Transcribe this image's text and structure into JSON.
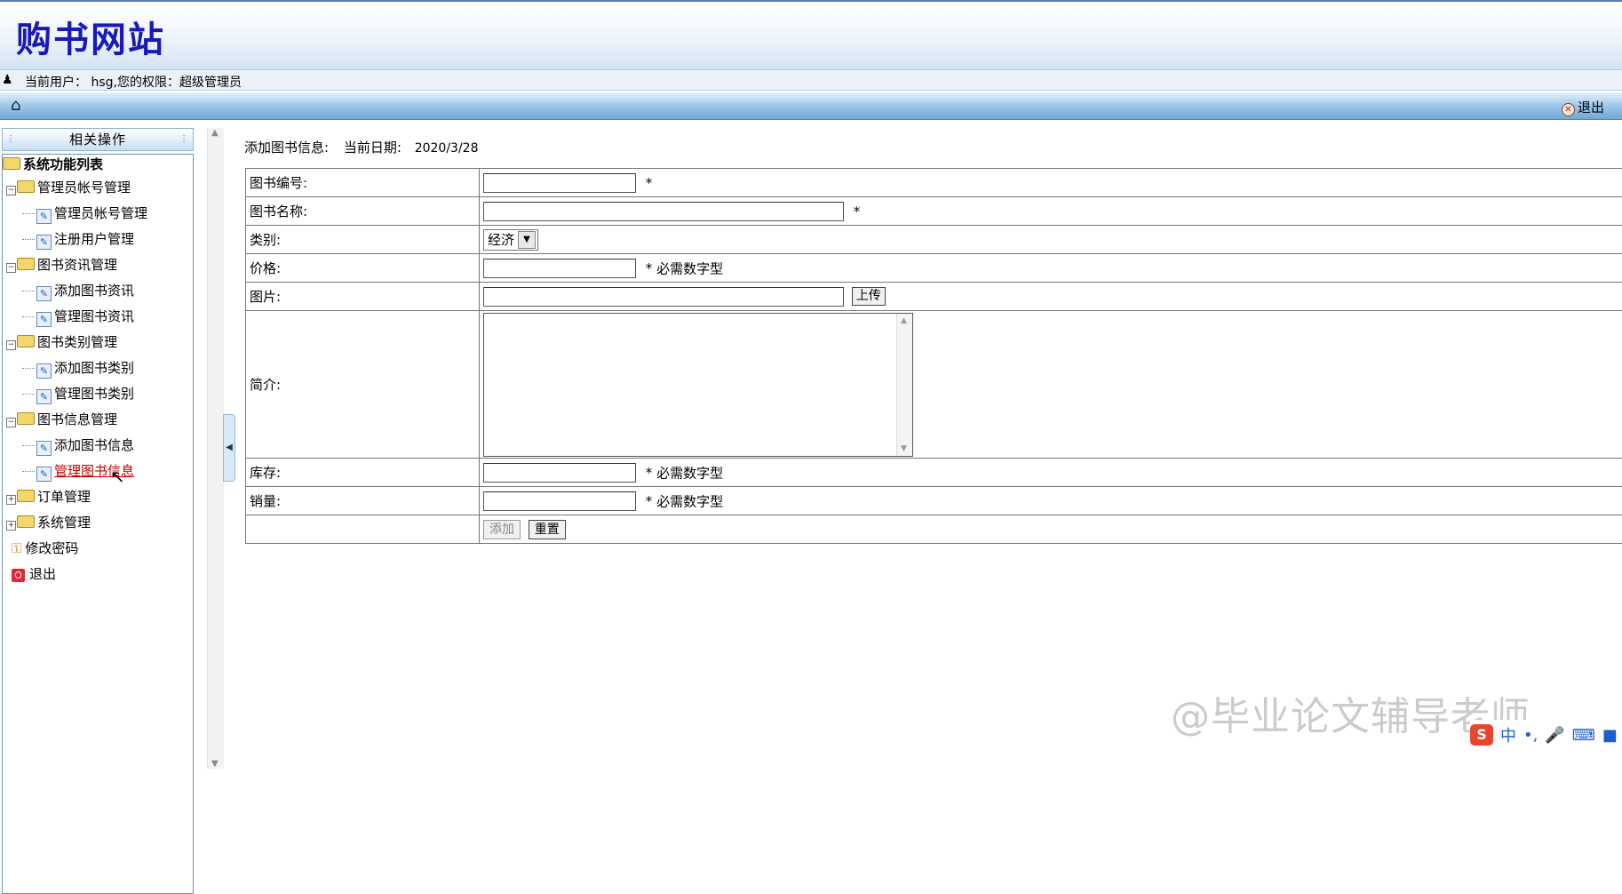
{
  "header": {
    "site_title": "购书网站",
    "user_info": "当前用户： hsg,您的权限：超级管理员",
    "logout_label": "退出"
  },
  "sidebar": {
    "heading": "相关操作",
    "root_label": "系统功能列表",
    "groups": [
      {
        "label": "管理员帐号管理",
        "items": [
          "管理员帐号管理",
          "注册用户管理"
        ]
      },
      {
        "label": "图书资讯管理",
        "items": [
          "添加图书资讯",
          "管理图书资讯"
        ]
      },
      {
        "label": "图书类别管理",
        "items": [
          "添加图书类别",
          "管理图书类别"
        ]
      },
      {
        "label": "图书信息管理",
        "items": [
          "添加图书信息",
          "管理图书信息"
        ]
      },
      {
        "label": "订单管理",
        "items": []
      },
      {
        "label": "系统管理",
        "items": []
      }
    ],
    "change_password": "修改密码",
    "exit": "退出"
  },
  "main": {
    "heading": "添加图书信息:",
    "date_label": "当前日期:",
    "date_value": "2020/3/28",
    "form": {
      "book_no_label": "图书编号:",
      "book_name_label": "图书名称:",
      "category_label": "类别:",
      "category_value": "经济",
      "price_label": "价格:",
      "image_label": "图片:",
      "upload_label": "上传",
      "intro_label": "简介:",
      "stock_label": "库存:",
      "sales_label": "销量:",
      "required_mark": "*",
      "numeric_note": "必需数字型",
      "add_label": "添加",
      "reset_label": "重置"
    }
  },
  "overlay": {
    "watermark": "@毕业论文辅导老师",
    "ime_label": "中"
  }
}
